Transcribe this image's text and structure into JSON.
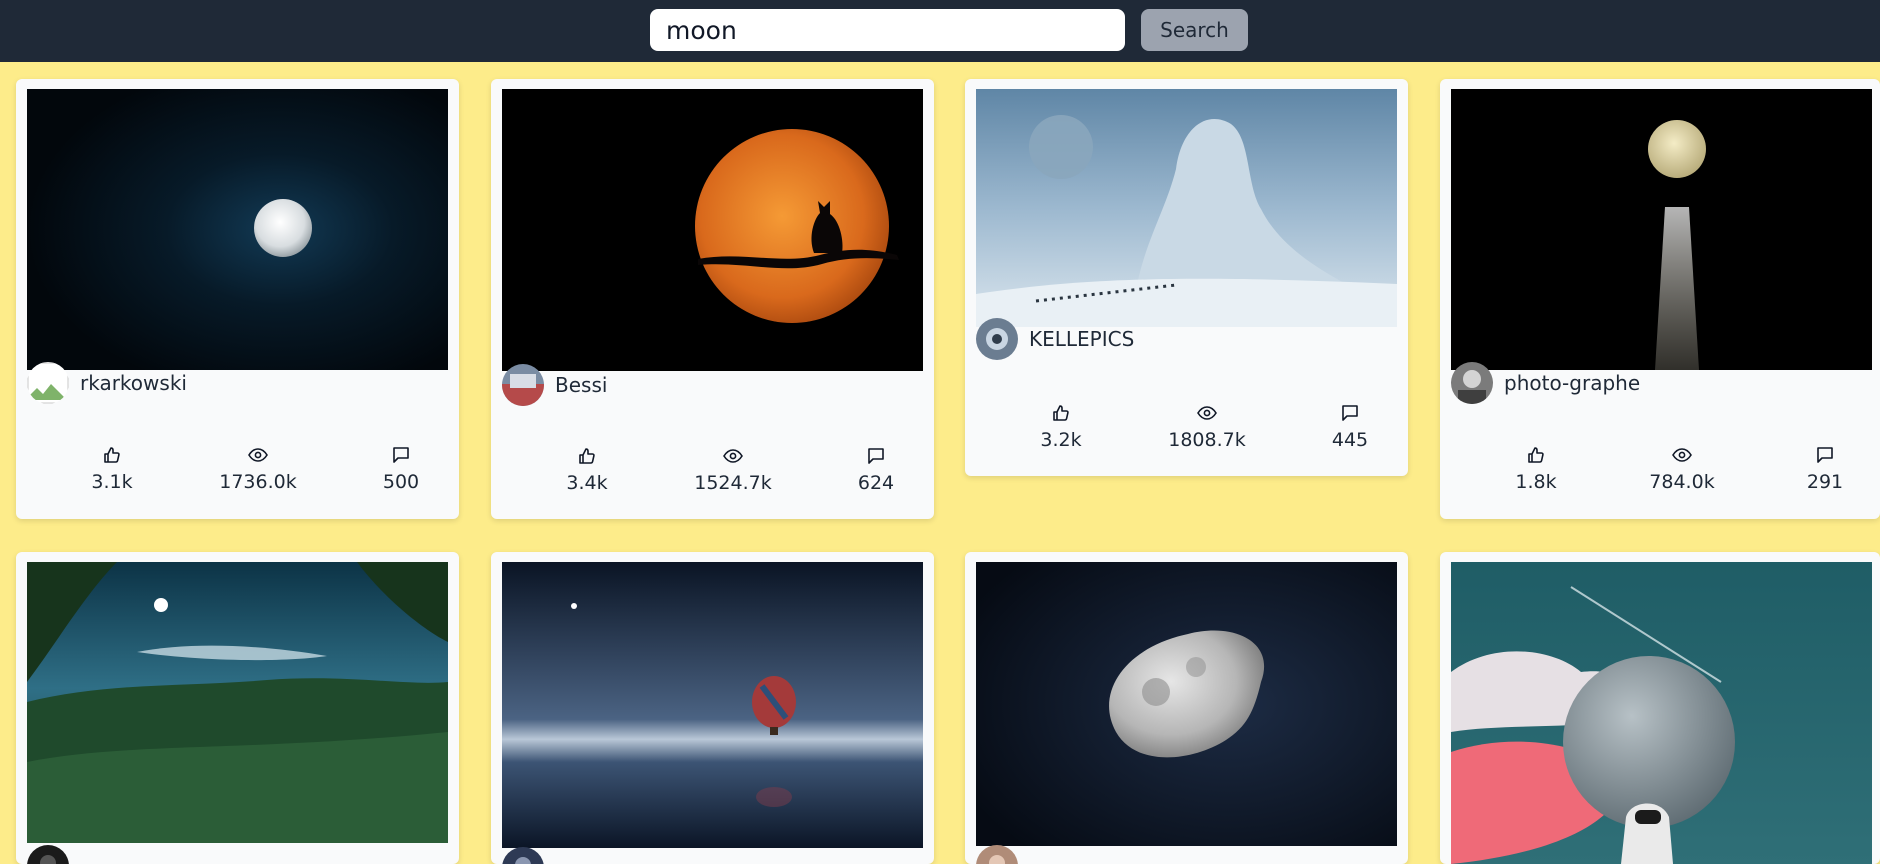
{
  "search": {
    "value": "moon",
    "button_label": "Search"
  },
  "colors": {
    "page_bg": "#fdec8a",
    "topbar_bg": "#1f2937",
    "card_bg": "#f9fafb",
    "button_bg": "#9ca3af"
  },
  "cards": [
    {
      "user": "rkarkowski",
      "likes": "3.1k",
      "views": "1736.0k",
      "comments": "500",
      "avatar": "broken-image"
    },
    {
      "user": "Bessi",
      "likes": "3.4k",
      "views": "1524.7k",
      "comments": "624",
      "avatar": "photo"
    },
    {
      "user": "KELLEPICS",
      "likes": "3.2k",
      "views": "1808.7k",
      "comments": "445",
      "avatar": "photo"
    },
    {
      "user": "photo-graphe",
      "likes": "1.8k",
      "views": "784.0k",
      "comments": "291",
      "avatar": "photo"
    },
    {
      "user": "",
      "avatar": "photo"
    },
    {
      "user": "",
      "avatar": "photo"
    },
    {
      "user": "",
      "avatar": "photo"
    },
    {
      "user": "",
      "avatar": "photo"
    }
  ],
  "icons": {
    "likes": "thumbs-up-icon",
    "views": "eye-icon",
    "comments": "comment-icon"
  }
}
